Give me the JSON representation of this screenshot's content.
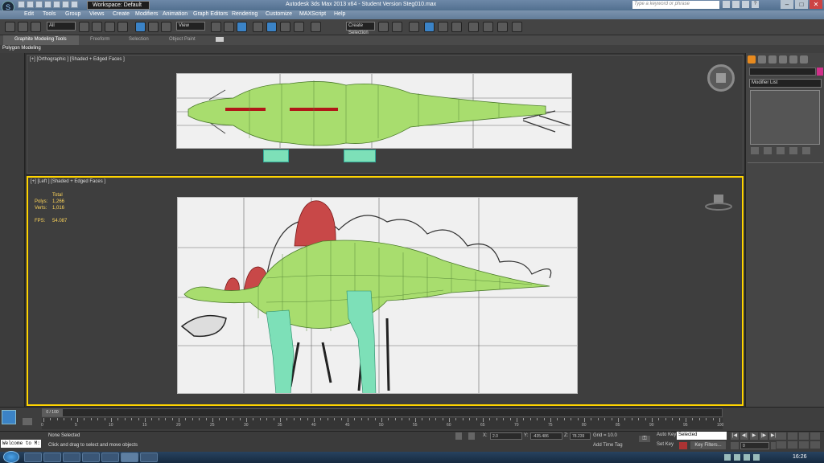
{
  "titlebar": {
    "workspace": "Workspace: Default",
    "title": "Autodesk 3ds Max  2013 x64   -   Student Version    Steg010.max",
    "search_placeholder": "Type a keyword or phrase"
  },
  "menu": [
    "Edit",
    "Tools",
    "Group",
    "Views",
    "Create",
    "Modifiers",
    "Animation",
    "Graph Editors",
    "Rendering",
    "Customize",
    "MAXScript",
    "Help"
  ],
  "toolbar": {
    "selection_filter": "All",
    "ref_coord": "View",
    "named_selection": "Create Selection Se"
  },
  "ribbon": {
    "tabs": [
      "Graphite Modeling Tools",
      "Freeform",
      "Selection",
      "Object Paint"
    ],
    "sub_label": "Polygon Modeling"
  },
  "viewports": {
    "top_label": "[+] [Orthographic ] [Shaded + Edged Faces ]",
    "left_label": "[+] [Left ] [Shaded + Edged Faces ]",
    "stats": {
      "header": "Total",
      "polys_label": "Polys:",
      "polys_value": "1,266",
      "verts_label": "Verts:",
      "verts_value": "1,016",
      "fps_label": "FPS:",
      "fps_value": "54.087"
    }
  },
  "command_panel": {
    "modifier_list": "Modifier List"
  },
  "timeline": {
    "frame_indicator": "0 / 100",
    "ticks": [
      "0",
      "5",
      "10",
      "15",
      "20",
      "25",
      "30",
      "35",
      "40",
      "45",
      "50",
      "55",
      "60",
      "65",
      "70",
      "75",
      "80",
      "85",
      "90",
      "95",
      "100"
    ]
  },
  "status": {
    "welcome": "Welcome to M:",
    "selection": "None Selected",
    "prompt": "Click and drag to select and move objects",
    "x_label": "X:",
    "x_value": "2.0",
    "y_label": "Y:",
    "y_value": "-435.486",
    "z_label": "Z:",
    "z_value": "78.239",
    "grid": "Grid = 10.0",
    "add_time_tag": "Add Time Tag",
    "auto_key": "Auto Key",
    "auto_key_mode": "Selected",
    "set_key": "Set Key",
    "key_filters": "Key Filters...",
    "frame": "0"
  },
  "taskbar": {
    "clock": "16:26"
  },
  "colors": {
    "active_viewport_border": "#ffd400",
    "mesh_green": "#a8dd6e",
    "plates_red": "#c84848",
    "legs_teal": "#7de0b8",
    "stats_yellow": "#ffd65a"
  }
}
